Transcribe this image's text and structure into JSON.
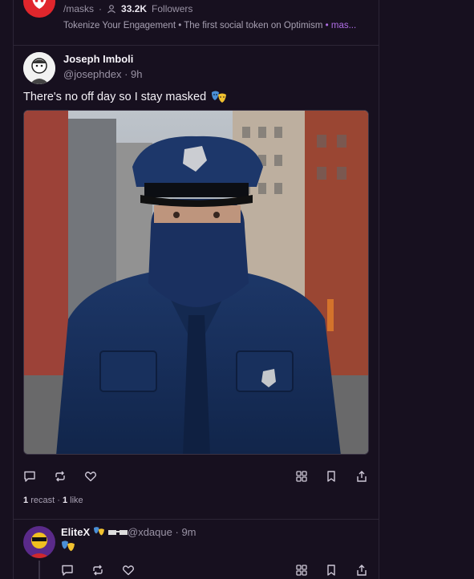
{
  "channel": {
    "name": "/masks",
    "followers_count": "33.2K",
    "followers_label": "Followers",
    "description": "Tokenize Your Engagement • The first social token on Optimism",
    "description_tag": "• mas..."
  },
  "cast": {
    "author": "Joseph Imboli",
    "handle": "@josephdex",
    "time": "9h",
    "text": "There's no off day so I stay masked",
    "recasts_count": "1",
    "recasts_label": "recast",
    "likes_count": "1",
    "likes_label": "like"
  },
  "reply": {
    "author": "EliteX",
    "handle": "@xdaque",
    "time": "9m"
  },
  "colors": {
    "background": "#17101f",
    "border": "#2c2536",
    "accent": "#b06ee6",
    "channel_brand": "#e0262c"
  },
  "icons": [
    "comment-icon",
    "recast-icon",
    "heart-icon",
    "grid-icon",
    "bookmark-icon",
    "share-icon",
    "masks-icon",
    "person-icon"
  ]
}
